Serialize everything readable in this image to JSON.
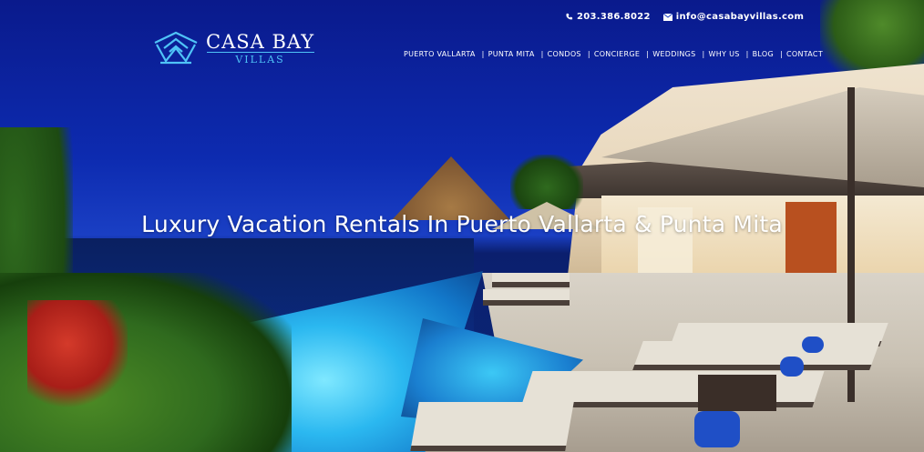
{
  "header": {
    "logo": {
      "main": "CASA BAY",
      "sub": "VILLAS",
      "accent_color": "#4fc3f7"
    },
    "contact": {
      "phone": "203.386.8022",
      "phone_icon": "phone-icon",
      "email": "info@casabayvillas.com",
      "email_icon": "envelope-icon"
    },
    "nav": {
      "items": [
        {
          "label": "PUERTO VALLARTA"
        },
        {
          "label": "PUNTA MITA"
        },
        {
          "label": "CONDOS"
        },
        {
          "label": "CONCIERGE"
        },
        {
          "label": "WEDDINGS"
        },
        {
          "label": "WHY US"
        },
        {
          "label": "BLOG"
        },
        {
          "label": "CONTACT"
        }
      ],
      "separator": "|"
    }
  },
  "hero": {
    "headline": "Luxury Vacation Rentals In Puerto Vallarta & Punta Mita"
  }
}
